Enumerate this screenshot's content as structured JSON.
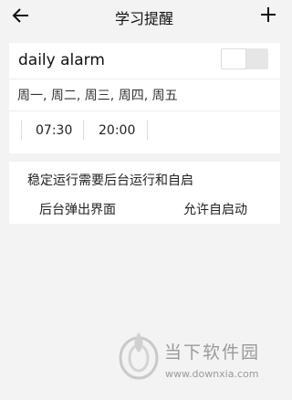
{
  "header": {
    "title": "学习提醒",
    "back_icon": "arrow-left-icon",
    "add_icon": "plus-icon"
  },
  "alarm": {
    "name": "daily alarm",
    "enabled": false,
    "days": "周一, 周二, 周三, 周四, 周五",
    "times": [
      "07:30",
      "20:00"
    ]
  },
  "background_notice": {
    "text": "稳定运行需要后台运行和自启",
    "popup_button": "后台弹出界面",
    "autostart_button": "允许自启动"
  },
  "watermark": {
    "name": "当下软件园",
    "url": "www.downxia.com"
  }
}
